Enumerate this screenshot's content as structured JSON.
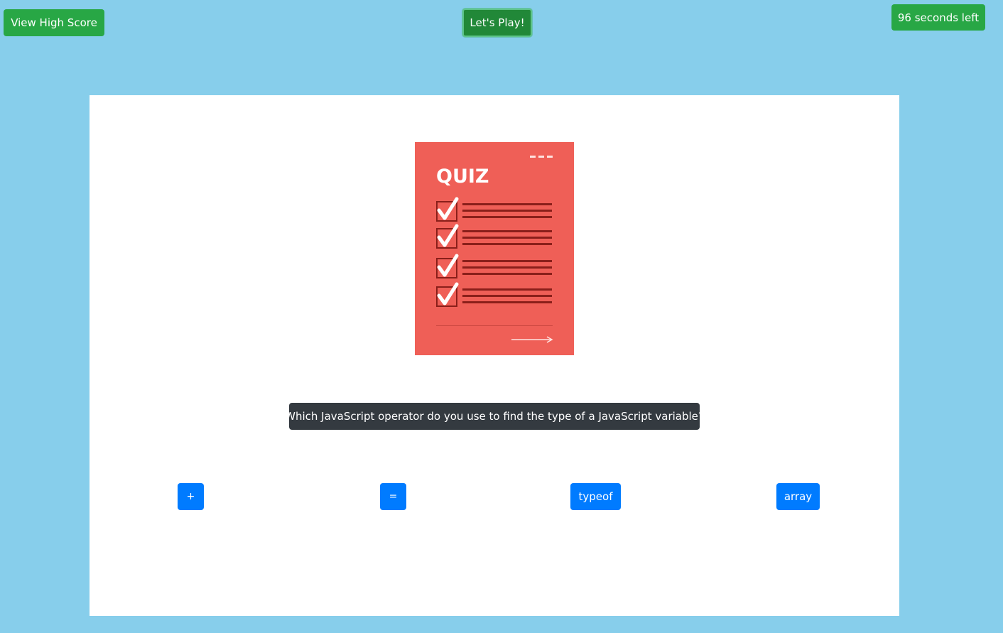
{
  "header": {
    "high_score_label": "View High Score",
    "play_label": "Let's Play!",
    "timer_text": "96 seconds left"
  },
  "quiz_image": {
    "icon": "quiz-checklist-illustration",
    "title": "QUIZ",
    "background_color": "#ef5f57",
    "checklist_rows": 4
  },
  "question": {
    "text": "Which JavaScript operator do you use to find the type of a JavaScript variable?"
  },
  "answers": [
    {
      "label": "+"
    },
    {
      "label": "="
    },
    {
      "label": "typeof"
    },
    {
      "label": "array"
    }
  ],
  "colors": {
    "page_background": "#87ceeb",
    "success": "#28a745",
    "primary": "#007bff",
    "dark": "#343a40"
  }
}
